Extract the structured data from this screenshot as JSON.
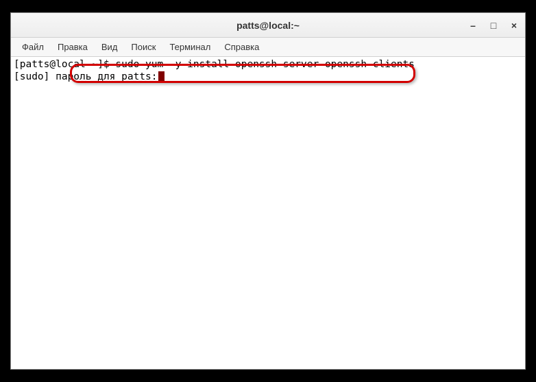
{
  "window": {
    "title": "patts@local:~"
  },
  "menubar": {
    "file": "Файл",
    "edit": "Правка",
    "view": "Вид",
    "search": "Поиск",
    "terminal": "Терминал",
    "help": "Справка"
  },
  "terminal": {
    "line1": "[patts@local ~]$ sudo yum -y install openssh-server openssh-clients",
    "sudo_prefix": "[sudo] ",
    "password_prompt": "пароль для patts: "
  },
  "controls": {
    "minimize": "–",
    "maximize": "□",
    "close": "×"
  }
}
